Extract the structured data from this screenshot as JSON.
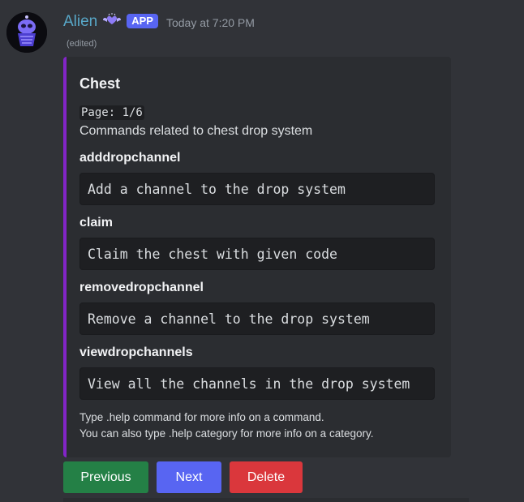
{
  "author": {
    "name": "Alien",
    "app_tag": "APP",
    "timestamp": "Today at 7:20 PM",
    "edited": "(edited)",
    "badge_icon": "winged-heart-icon"
  },
  "embed": {
    "accent_color": "#8225c7",
    "title": "Chest",
    "page": "Page: 1/6",
    "description": "Commands related to chest drop system",
    "fields": [
      {
        "name": "adddropchannel",
        "value": "Add a channel to the drop system"
      },
      {
        "name": "claim",
        "value": "Claim the chest with given code"
      },
      {
        "name": "removedropchannel",
        "value": "Remove a channel to the drop system"
      },
      {
        "name": "viewdropchannels",
        "value": "View all the channels in the drop system"
      }
    ],
    "footer_lines": [
      "Type .help command for more info on a command.",
      "You can also type .help category for more info on a category."
    ]
  },
  "buttons": {
    "previous": "Previous",
    "next": "Next",
    "delete": "Delete"
  },
  "colors": {
    "background": "#313338",
    "embed_bg": "#2b2d31",
    "username": "#58a8c9",
    "app_tag": "#5865f2",
    "success": "#248046",
    "primary": "#5865f2",
    "danger": "#da373c"
  }
}
